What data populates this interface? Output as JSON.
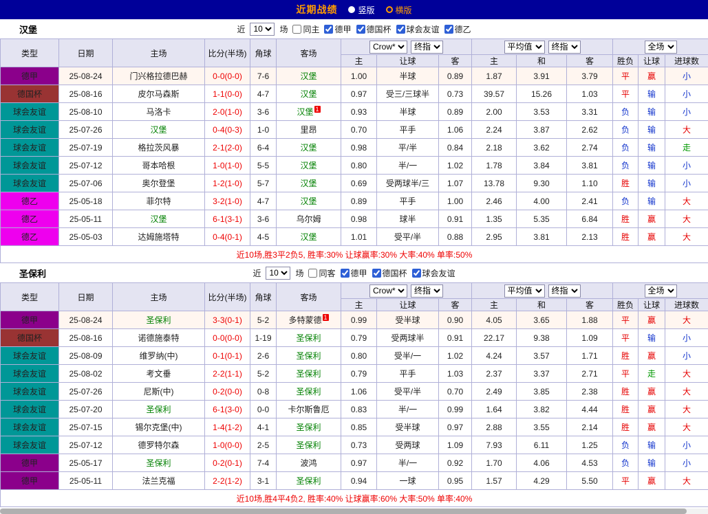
{
  "topbar": {
    "title": "近期战绩",
    "layout_options": [
      {
        "label": "竖版",
        "selected": false
      },
      {
        "label": "横版",
        "selected": true
      }
    ]
  },
  "filter_labels": {
    "near": "近",
    "games": "场"
  },
  "columns": {
    "type": "类型",
    "date": "日期",
    "home": "主场",
    "score": "比分(半场)",
    "corner": "角球",
    "away": "客场",
    "odds_home": "主",
    "odds_handicap": "让球",
    "odds_away": "客",
    "avg_home": "主",
    "avg_draw": "和",
    "avg_away": "客",
    "result": "胜负",
    "handicap_result": "让球",
    "goals": "进球数"
  },
  "header_selects": {
    "odds_source": "Crow*",
    "odds_stage": "终指",
    "avg_source": "平均值",
    "avg_stage": "终指",
    "fulltime": "全场"
  },
  "league_colors": {
    "德甲": "#8B008B",
    "德国杯": "#993333",
    "球会友谊": "#009797",
    "德乙": "#EE00EE"
  },
  "result_colors": {
    "胜": "#E60000",
    "平": "#E60000",
    "负": "#1133CC",
    "赢": "#E60000",
    "输": "#1133CC",
    "走": "#009900",
    "大": "#E60000",
    "小": "#1133CC"
  },
  "colors": {
    "topbar_bg": "#000099",
    "title_orange": "#FF9C00",
    "subject_green": "#008000",
    "score_red": "#EE0000",
    "summary_red": "#EE0000",
    "header_bg": "#E4E4F2",
    "border": "#B0B0D8"
  },
  "tables": [
    {
      "team": "汉堡",
      "match_count": "10",
      "same_venue_label": "同主",
      "league_filters": [
        "德甲",
        "德国杯",
        "球会友谊",
        "德乙"
      ],
      "summary": "近10场,胜3平2负5, 胜率:30% 让球赢率:30% 大率:40% 单率:50%",
      "rows": [
        {
          "league": "德甲",
          "date": "25-08-24",
          "home": "门兴格拉德巴赫",
          "home_subject": false,
          "score": "0-0(0-0)",
          "corner": "7-6",
          "away": "汉堡",
          "away_subject": true,
          "odds": [
            "1.00",
            "半球",
            "0.89"
          ],
          "avg": [
            "1.87",
            "3.91",
            "3.79"
          ],
          "results": [
            "平",
            "赢",
            "小"
          ],
          "highlight": true
        },
        {
          "league": "德国杯",
          "date": "25-08-16",
          "home": "皮尔马森斯",
          "home_subject": false,
          "score": "1-1(0-0)",
          "corner": "4-7",
          "away": "汉堡",
          "away_subject": true,
          "odds": [
            "0.97",
            "受三/三球半",
            "0.73"
          ],
          "avg": [
            "39.57",
            "15.26",
            "1.03"
          ],
          "results": [
            "平",
            "输",
            "小"
          ]
        },
        {
          "league": "球会友谊",
          "date": "25-08-10",
          "home": "马洛卡",
          "home_subject": false,
          "score": "2-0(1-0)",
          "corner": "3-6",
          "away": "汉堡",
          "away_subject": true,
          "away_card": "1",
          "odds": [
            "0.93",
            "半球",
            "0.89"
          ],
          "avg": [
            "2.00",
            "3.53",
            "3.31"
          ],
          "results": [
            "负",
            "输",
            "小"
          ]
        },
        {
          "league": "球会友谊",
          "date": "25-07-26",
          "home": "汉堡",
          "home_subject": true,
          "score": "0-4(0-3)",
          "corner": "1-0",
          "away": "里昂",
          "away_subject": false,
          "odds": [
            "0.70",
            "平手",
            "1.06"
          ],
          "avg": [
            "2.24",
            "3.87",
            "2.62"
          ],
          "results": [
            "负",
            "输",
            "大"
          ]
        },
        {
          "league": "球会友谊",
          "date": "25-07-19",
          "home": "格拉茨风暴",
          "home_subject": false,
          "score": "2-1(2-0)",
          "corner": "6-4",
          "away": "汉堡",
          "away_subject": true,
          "odds": [
            "0.98",
            "平/半",
            "0.84"
          ],
          "avg": [
            "2.18",
            "3.62",
            "2.74"
          ],
          "results": [
            "负",
            "输",
            "走"
          ]
        },
        {
          "league": "球会友谊",
          "date": "25-07-12",
          "home": "哥本哈根",
          "home_subject": false,
          "score": "1-0(1-0)",
          "corner": "5-5",
          "away": "汉堡",
          "away_subject": true,
          "odds": [
            "0.80",
            "半/一",
            "1.02"
          ],
          "avg": [
            "1.78",
            "3.84",
            "3.81"
          ],
          "results": [
            "负",
            "输",
            "小"
          ]
        },
        {
          "league": "球会友谊",
          "date": "25-07-06",
          "home": "奥尔登堡",
          "home_subject": false,
          "score": "1-2(1-0)",
          "corner": "5-7",
          "away": "汉堡",
          "away_subject": true,
          "odds": [
            "0.69",
            "受两球半/三",
            "1.07"
          ],
          "avg": [
            "13.78",
            "9.30",
            "1.10"
          ],
          "results": [
            "胜",
            "输",
            "小"
          ]
        },
        {
          "league": "德乙",
          "date": "25-05-18",
          "home": "菲尔特",
          "home_subject": false,
          "score": "3-2(1-0)",
          "corner": "4-7",
          "away": "汉堡",
          "away_subject": true,
          "odds": [
            "0.89",
            "平手",
            "1.00"
          ],
          "avg": [
            "2.46",
            "4.00",
            "2.41"
          ],
          "results": [
            "负",
            "输",
            "大"
          ]
        },
        {
          "league": "德乙",
          "date": "25-05-11",
          "home": "汉堡",
          "home_subject": true,
          "score": "6-1(3-1)",
          "corner": "3-6",
          "away": "乌尔姆",
          "away_subject": false,
          "odds": [
            "0.98",
            "球半",
            "0.91"
          ],
          "avg": [
            "1.35",
            "5.35",
            "6.84"
          ],
          "results": [
            "胜",
            "赢",
            "大"
          ]
        },
        {
          "league": "德乙",
          "date": "25-05-03",
          "home": "达姆施塔特",
          "home_subject": false,
          "score": "0-4(0-1)",
          "corner": "4-5",
          "away": "汉堡",
          "away_subject": true,
          "odds": [
            "1.01",
            "受平/半",
            "0.88"
          ],
          "avg": [
            "2.95",
            "3.81",
            "2.13"
          ],
          "results": [
            "胜",
            "赢",
            "大"
          ]
        }
      ]
    },
    {
      "team": "圣保利",
      "match_count": "10",
      "same_venue_label": "同客",
      "league_filters": [
        "德甲",
        "德国杯",
        "球会友谊"
      ],
      "summary": "近10场,胜4平4负2, 胜率:40% 让球赢率:60% 大率:50% 单率:40%",
      "rows": [
        {
          "league": "德甲",
          "date": "25-08-24",
          "home": "圣保利",
          "home_subject": true,
          "score": "3-3(0-1)",
          "corner": "5-2",
          "away": "多特蒙德",
          "away_subject": false,
          "away_card": "1",
          "odds": [
            "0.99",
            "受半球",
            "0.90"
          ],
          "avg": [
            "4.05",
            "3.65",
            "1.88"
          ],
          "results": [
            "平",
            "赢",
            "大"
          ],
          "highlight": true
        },
        {
          "league": "德国杯",
          "date": "25-08-16",
          "home": "诺德施泰特",
          "home_subject": false,
          "score": "0-0(0-0)",
          "corner": "1-19",
          "away": "圣保利",
          "away_subject": true,
          "odds": [
            "0.79",
            "受两球半",
            "0.91"
          ],
          "avg": [
            "22.17",
            "9.38",
            "1.09"
          ],
          "results": [
            "平",
            "输",
            "小"
          ]
        },
        {
          "league": "球会友谊",
          "date": "25-08-09",
          "home": "维罗纳(中)",
          "home_subject": false,
          "score": "0-1(0-1)",
          "corner": "2-6",
          "away": "圣保利",
          "away_subject": true,
          "odds": [
            "0.80",
            "受半/一",
            "1.02"
          ],
          "avg": [
            "4.24",
            "3.57",
            "1.71"
          ],
          "results": [
            "胜",
            "赢",
            "小"
          ]
        },
        {
          "league": "球会友谊",
          "date": "25-08-02",
          "home": "考文垂",
          "home_subject": false,
          "score": "2-2(1-1)",
          "corner": "5-2",
          "away": "圣保利",
          "away_subject": true,
          "odds": [
            "0.79",
            "平手",
            "1.03"
          ],
          "avg": [
            "2.37",
            "3.37",
            "2.71"
          ],
          "results": [
            "平",
            "走",
            "大"
          ]
        },
        {
          "league": "球会友谊",
          "date": "25-07-26",
          "home": "尼斯(中)",
          "home_subject": false,
          "score": "0-2(0-0)",
          "corner": "0-8",
          "away": "圣保利",
          "away_subject": true,
          "odds": [
            "1.06",
            "受平/半",
            "0.70"
          ],
          "avg": [
            "2.49",
            "3.85",
            "2.38"
          ],
          "results": [
            "胜",
            "赢",
            "大"
          ]
        },
        {
          "league": "球会友谊",
          "date": "25-07-20",
          "home": "圣保利",
          "home_subject": true,
          "score": "6-1(3-0)",
          "corner": "0-0",
          "away": "卡尔斯鲁厄",
          "away_subject": false,
          "odds": [
            "0.83",
            "半/一",
            "0.99"
          ],
          "avg": [
            "1.64",
            "3.82",
            "4.44"
          ],
          "results": [
            "胜",
            "赢",
            "大"
          ]
        },
        {
          "league": "球会友谊",
          "date": "25-07-15",
          "home": "锡尔克堡(中)",
          "home_subject": false,
          "score": "1-4(1-2)",
          "corner": "4-1",
          "away": "圣保利",
          "away_subject": true,
          "odds": [
            "0.85",
            "受半球",
            "0.97"
          ],
          "avg": [
            "2.88",
            "3.55",
            "2.14"
          ],
          "results": [
            "胜",
            "赢",
            "大"
          ]
        },
        {
          "league": "球会友谊",
          "date": "25-07-12",
          "home": "德罗特尔森",
          "home_subject": false,
          "score": "1-0(0-0)",
          "corner": "2-5",
          "away": "圣保利",
          "away_subject": true,
          "odds": [
            "0.73",
            "受两球",
            "1.09"
          ],
          "avg": [
            "7.93",
            "6.11",
            "1.25"
          ],
          "results": [
            "负",
            "输",
            "小"
          ]
        },
        {
          "league": "德甲",
          "date": "25-05-17",
          "home": "圣保利",
          "home_subject": true,
          "score": "0-2(0-1)",
          "corner": "7-4",
          "away": "波鸿",
          "away_subject": false,
          "odds": [
            "0.97",
            "半/一",
            "0.92"
          ],
          "avg": [
            "1.70",
            "4.06",
            "4.53"
          ],
          "results": [
            "负",
            "输",
            "小"
          ]
        },
        {
          "league": "德甲",
          "date": "25-05-11",
          "home": "法兰克福",
          "home_subject": false,
          "score": "2-2(1-2)",
          "corner": "3-1",
          "away": "圣保利",
          "away_subject": true,
          "odds": [
            "0.94",
            "一球",
            "0.95"
          ],
          "avg": [
            "1.57",
            "4.29",
            "5.50"
          ],
          "results": [
            "平",
            "赢",
            "大"
          ]
        }
      ]
    }
  ]
}
